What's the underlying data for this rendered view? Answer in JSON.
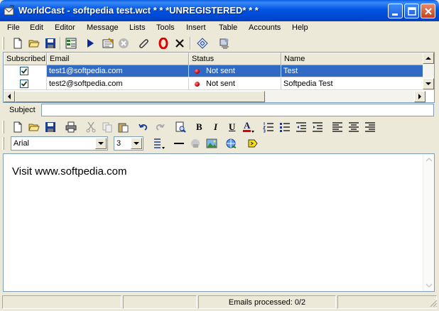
{
  "window": {
    "title": "WorldCast - softpedia test.wct * * *UNREGISTERED* * *",
    "minimize_label": "Minimize",
    "maximize_label": "Maximize",
    "close_label": "Close"
  },
  "menu": [
    "File",
    "Edit",
    "Editor",
    "Message",
    "Lists",
    "Tools",
    "Insert",
    "Table",
    "Accounts",
    "Help"
  ],
  "toolbar_main": [
    "new-icon",
    "open-icon",
    "save-icon",
    "address-book-icon",
    "send-icon",
    "preview-icon",
    "stop-icon",
    "attach-icon",
    "unsubscribe-icon",
    "delete-icon",
    "html-icon",
    "spellcheck-icon"
  ],
  "table": {
    "columns": [
      "Subscribed",
      "Email",
      "Status",
      "Name"
    ],
    "rows": [
      {
        "subscribed": true,
        "email": "test1@softpedia.com",
        "status": "Not sent",
        "name": "Test"
      },
      {
        "subscribed": true,
        "email": "test2@softpedia.com",
        "status": "Not sent",
        "name": "Softpedia Test"
      }
    ]
  },
  "subject": {
    "label": "Subject",
    "value": ""
  },
  "format": {
    "font": "Arial",
    "size": "3",
    "bold": "B",
    "italic": "I",
    "underline": "U",
    "font_color": "A"
  },
  "editor": {
    "body": "Visit www.softpedia.com"
  },
  "status": {
    "text": "Emails processed: 0/2"
  },
  "colors": {
    "title_bar": "#0054e3",
    "selection": "#316ac5",
    "status_dot": "#d00000"
  }
}
